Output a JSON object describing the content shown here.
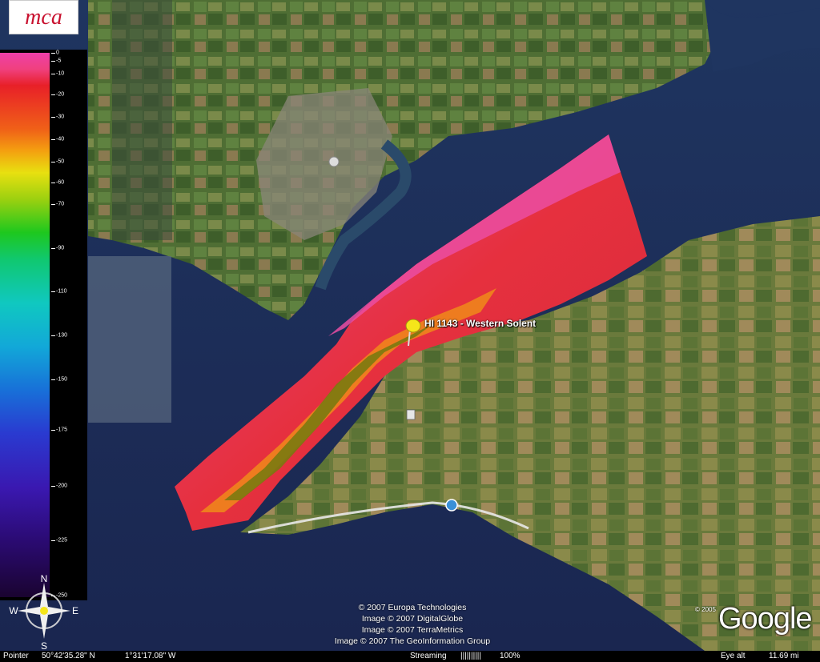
{
  "logo": {
    "text": "mca"
  },
  "legend": {
    "ticks": [
      "0",
      "-5",
      "-10",
      "-20",
      "-30",
      "-40",
      "-50",
      "-60",
      "-70",
      "-90",
      "-110",
      "-130",
      "-150",
      "-175",
      "-200",
      "-225",
      "-250"
    ]
  },
  "placemark": {
    "label": "HI 1143 - Western Solent",
    "color": "#f5e51a"
  },
  "compass": {
    "n": "N",
    "s": "S",
    "e": "E",
    "w": "W"
  },
  "credits": [
    "© 2007 Europa Technologies",
    "Image © 2007 DigitalGlobe",
    "Image © 2007 TerraMetrics",
    "Image © 2007 The GeoInformation Group"
  ],
  "google": {
    "logo": "Google",
    "year": "© 2005"
  },
  "status": {
    "pointer_label": "Pointer",
    "lat": "50°42'35.28\" N",
    "lon": "1°31'17.08\" W",
    "streaming_label": "Streaming",
    "streaming_bars": "||||||||||",
    "streaming_pct": "100%",
    "eye_alt_label": "Eye  alt",
    "eye_alt_value": "11.69 mi"
  },
  "colors": {
    "sea": "#1d3a6e",
    "land": "#5a7a3a",
    "survey_pink": "#e83c8c",
    "survey_red": "#e0303a",
    "survey_orange": "#f08a1a",
    "survey_olive": "#7a7a10"
  }
}
